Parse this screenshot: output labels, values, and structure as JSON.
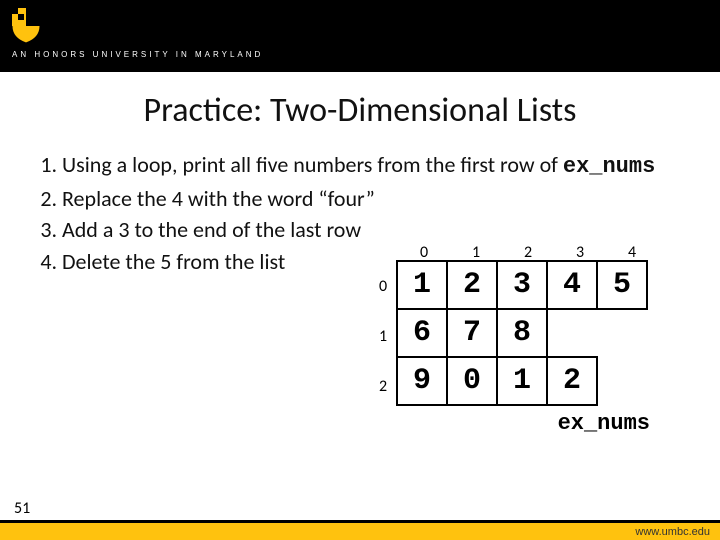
{
  "brand": {
    "name": "UMBC",
    "tagline": "AN HONORS UNIVERSITY IN MARYLAND",
    "site": "www.umbc.edu"
  },
  "slide": {
    "number": "51",
    "title": "Practice: Two-Dimensional Lists"
  },
  "tasks": {
    "t1_a": "Using a loop, print all five numbers from the first row of ",
    "t1_code": "ex_nums",
    "t2": "Replace the 4 with the word “four”",
    "t3": "Add a 3 to the end of the last row",
    "t4": "Delete the 5 from the list"
  },
  "table": {
    "var_name": "ex_nums",
    "col_indices": [
      "0",
      "1",
      "2",
      "3",
      "4"
    ],
    "row_indices": [
      "0",
      "1",
      "2"
    ],
    "rows": [
      [
        "1",
        "2",
        "3",
        "4",
        "5"
      ],
      [
        "6",
        "7",
        "8"
      ],
      [
        "9",
        "0",
        "1",
        "2"
      ]
    ]
  }
}
